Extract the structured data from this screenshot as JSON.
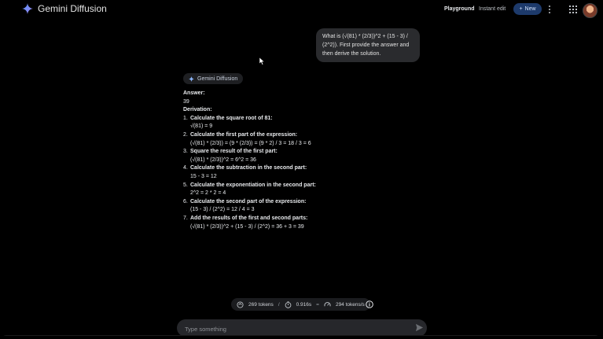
{
  "header": {
    "app_title": "Gemini Diffusion",
    "nav_playground": "Playground",
    "nav_instant_edit": "Instant edit",
    "new_button": "New",
    "new_icon": "plus-icon",
    "brand_icon": "gemini-sparkle-icon",
    "more_icon": "more-vert-icon",
    "apps_icon": "apps-grid-icon"
  },
  "conversation": {
    "user_message": "What is (√(81) * (2/3))^2 + (15 - 3) / (2^2)). First provide the answer and then derive the solution.",
    "model_chip": "Gemini Diffusion",
    "answer_label": "Answer:",
    "answer_value": "39",
    "derivation_label": "Derivation:",
    "steps": [
      {
        "num": "1.",
        "title": "Calculate the square root of 81:",
        "detail": "√(81) = 9"
      },
      {
        "num": "2.",
        "title": "Calculate the first part of the expression:",
        "detail": "(√(81) * (2/3)) = (9 * (2/3)) = (9 * 2) / 3 = 18 / 3 = 6"
      },
      {
        "num": "3.",
        "title": "Square the result of the first part:",
        "detail": "(√(81) * (2/3))^2 = 6^2 = 36"
      },
      {
        "num": "4.",
        "title": "Calculate the subtraction in the second part:",
        "detail": "15 - 3 = 12"
      },
      {
        "num": "5.",
        "title": "Calculate the exponentiation in the second part:",
        "detail": "2^2 = 2 * 2 = 4"
      },
      {
        "num": "6.",
        "title": "Calculate the second part of the expression:",
        "detail": "(15 - 3) / (2^2) = 12 / 4 = 3"
      },
      {
        "num": "7.",
        "title": "Add the results of the first and second parts:",
        "detail": "(√(81) * (2/3))^2 + (15 - 3) / (2^2) = 36 + 3 = 39"
      }
    ]
  },
  "stats": {
    "tokens": "269 tokens",
    "sep1": "/",
    "time": "0.916s",
    "sep2": "=",
    "rate": "294 tokens/s"
  },
  "composer": {
    "placeholder": "Type something"
  },
  "colors": {
    "background": "#000000",
    "bubble": "#2a2b2e",
    "new_button": "#1d3a6b",
    "brand_gradient_start": "#4f8df7",
    "brand_gradient_end": "#a58bf5"
  }
}
